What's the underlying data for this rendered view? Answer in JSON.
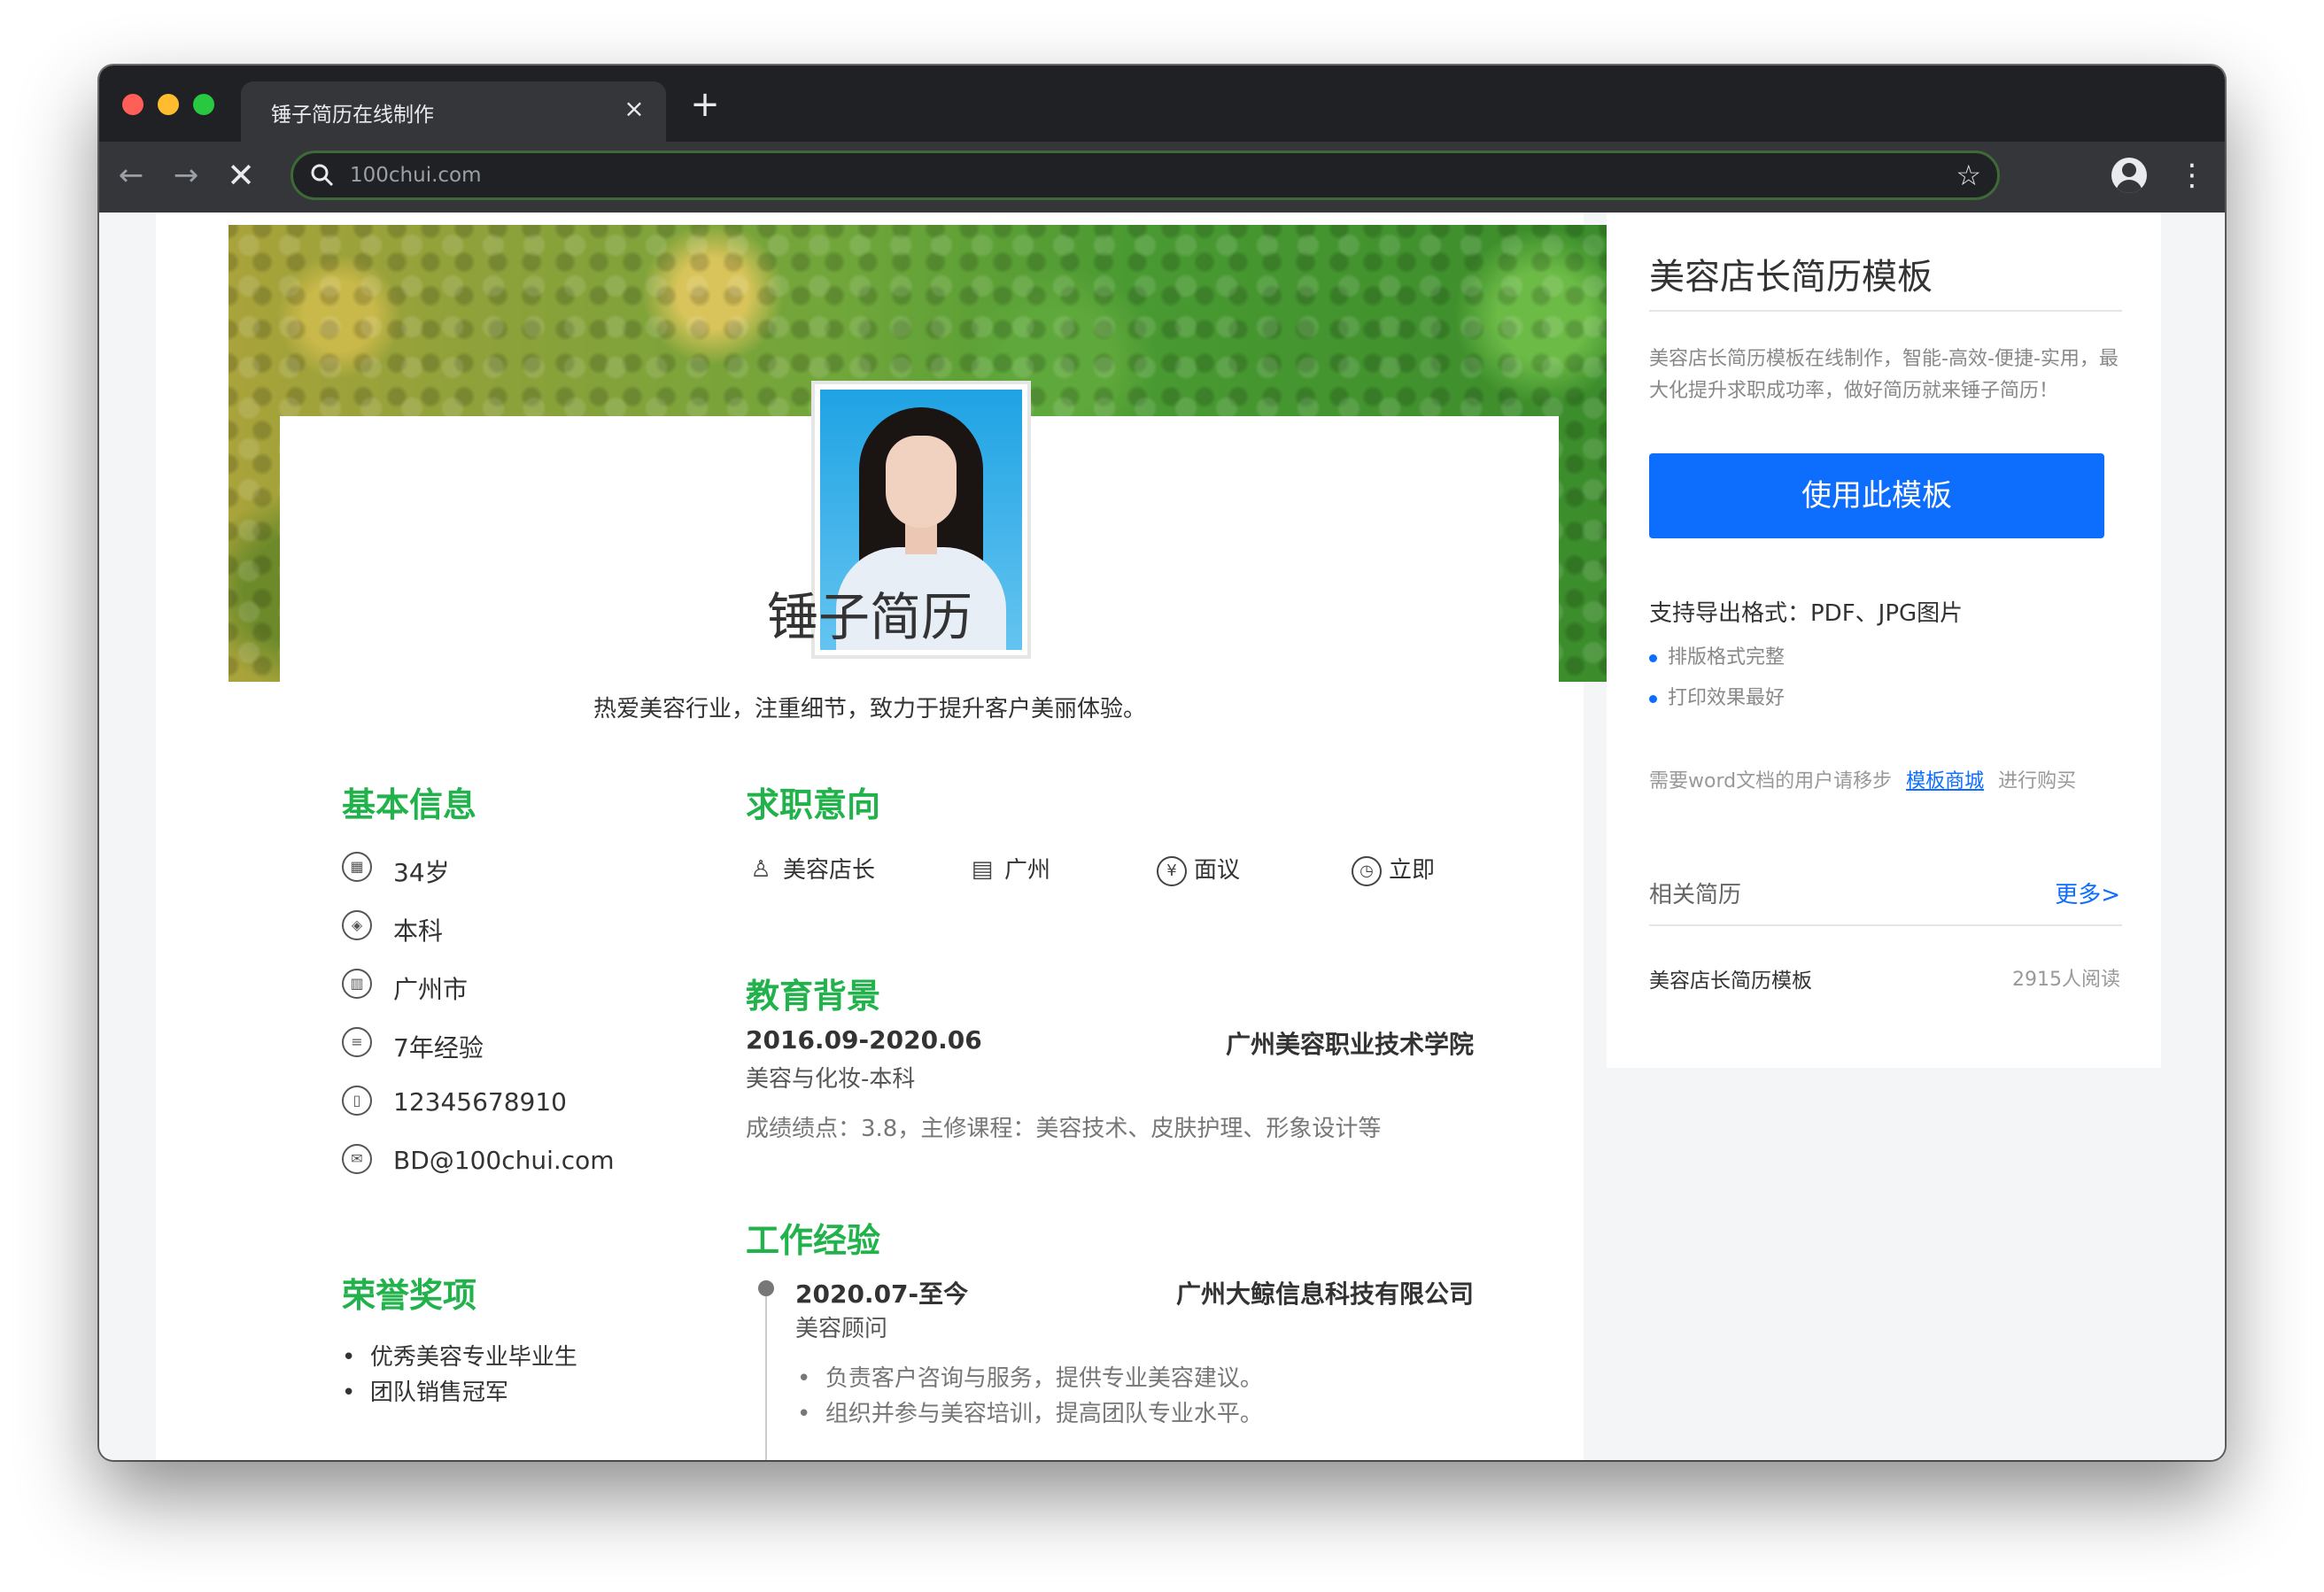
{
  "browser": {
    "tab_title": "锤子简历在线制作",
    "tab_close": "×",
    "new_tab": "+",
    "url": "100chui.com",
    "nav": {
      "back": "←",
      "forward": "→",
      "stop": "✕"
    },
    "star": "☆",
    "menu": "⋮"
  },
  "resume": {
    "name": "锤子简历",
    "tagline": "热爱美容行业，注重细节，致力于提升客户美丽体验。",
    "basic_info": {
      "title": "基本信息",
      "items": [
        {
          "icon": "calendar-icon",
          "glyph": "▦",
          "text": "34岁"
        },
        {
          "icon": "graduation-cap-icon",
          "glyph": "◈",
          "text": "本科"
        },
        {
          "icon": "building-icon",
          "glyph": "▥",
          "text": "广州市"
        },
        {
          "icon": "document-icon",
          "glyph": "≡",
          "text": "7年经验"
        },
        {
          "icon": "phone-icon",
          "glyph": "▯",
          "text": "12345678910"
        },
        {
          "icon": "email-icon",
          "glyph": "✉",
          "text": "BD@100chui.com"
        }
      ]
    },
    "job_intent": {
      "title": "求职意向",
      "items": [
        {
          "icon": "tie-icon",
          "glyph": "♙",
          "text": "美容店长"
        },
        {
          "icon": "city-icon",
          "glyph": "▤",
          "text": "广州"
        },
        {
          "icon": "yen-icon",
          "glyph": "¥",
          "text": "面议"
        },
        {
          "icon": "clock-icon",
          "glyph": "◷",
          "text": "立即"
        }
      ]
    },
    "education": {
      "title": "教育背景",
      "date": "2016.09-2020.06",
      "school": "广州美容职业技术学院",
      "major": "美容与化妆-本科",
      "detail": "成绩绩点：3.8，主修课程：美容技术、皮肤护理、形象设计等"
    },
    "experience": {
      "title": "工作经验",
      "date": "2020.07-至今",
      "company": "广州大鲸信息科技有限公司",
      "role": "美容顾问",
      "bullets": [
        "负责客户咨询与服务，提供专业美容建议。",
        "组织并参与美容培训，提高团队专业水平。"
      ]
    },
    "honors": {
      "title": "荣誉奖项",
      "items": [
        "优秀美容专业毕业生",
        "团队销售冠军"
      ]
    }
  },
  "sidebar": {
    "title": "美容店长简历模板",
    "description": "美容店长简历模板在线制作，智能-高效-便捷-实用，最大化提升求职成功率，做好简历就来锤子简历！",
    "use_button": "使用此模板",
    "formats": "支持导出格式：PDF、JPG图片",
    "features": [
      "排版格式完整",
      "打印效果最好"
    ],
    "word_note_prefix": "需要word文档的用户请移步",
    "word_note_link": "模板商城",
    "word_note_suffix": "进行购买",
    "related_title": "相关简历",
    "more_link": "更多>",
    "related_items": [
      {
        "title": "美容店长简历模板",
        "views": "2915人阅读"
      }
    ]
  },
  "colors": {
    "accent_green": "#21b24b",
    "primary_blue": "#0d6efd",
    "chrome_dark": "#202124"
  }
}
